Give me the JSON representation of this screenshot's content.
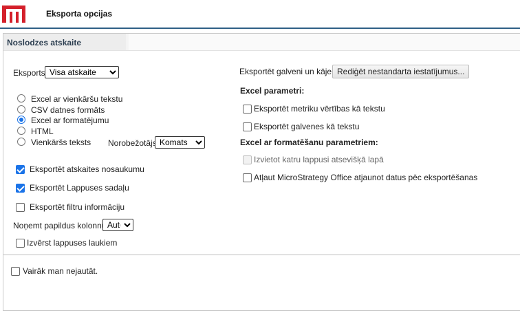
{
  "header": {
    "title": "Eksporta opcijas",
    "logo_color": "#d4202b"
  },
  "section": {
    "title": "Noslodzes atskaite"
  },
  "left": {
    "export_label": "Eksports:",
    "export_value": "Visa atskaite",
    "formats": [
      {
        "label": "Excel ar vienkāršu tekstu",
        "selected": false
      },
      {
        "label": "CSV datnes formāts",
        "selected": false
      },
      {
        "label": "Excel ar formatējumu",
        "selected": true
      },
      {
        "label": "HTML",
        "selected": false
      },
      {
        "label": "Vienkāršs teksts",
        "selected": false
      }
    ],
    "delimiter_label": "Norobežotājs:",
    "delimiter_value": "Komats",
    "checkboxes": [
      {
        "label": "Eksportēt atskaites nosaukumu",
        "checked": true
      },
      {
        "label": "Eksportēt Lappuses sadaļu",
        "checked": true
      },
      {
        "label": "Eksportēt filtru informāciju",
        "checked": false
      }
    ],
    "remove_columns_label": "Noņemt papildus kolonnu:",
    "remove_columns_value": "Auto",
    "expand_label": "Izvērst lappuses laukiem",
    "expand_checked": false
  },
  "right": {
    "headers_label": "Eksportēt galveni un kājeni:",
    "edit_button": "Rediģēt nestandarta iestatījumus...",
    "excel_params_title": "Excel parametri:",
    "excel_options": [
      {
        "label": "Eksportēt metriku vērtības kā tekstu",
        "checked": false
      },
      {
        "label": "Eksportēt galvenes kā tekstu",
        "checked": false
      }
    ],
    "formatted_params_title": "Excel ar formatēšanu parametriem:",
    "formatted_options": [
      {
        "label": "Izvietot katru lappusi atsevišķā lapā",
        "checked": false,
        "disabled": true
      },
      {
        "label": "Atļaut MicroStrategy Office atjaunot datus pēc eksportēšanas",
        "checked": false,
        "disabled": false
      }
    ]
  },
  "footer": {
    "dont_ask_label": "Vairāk man nejautāt.",
    "dont_ask_checked": false
  }
}
